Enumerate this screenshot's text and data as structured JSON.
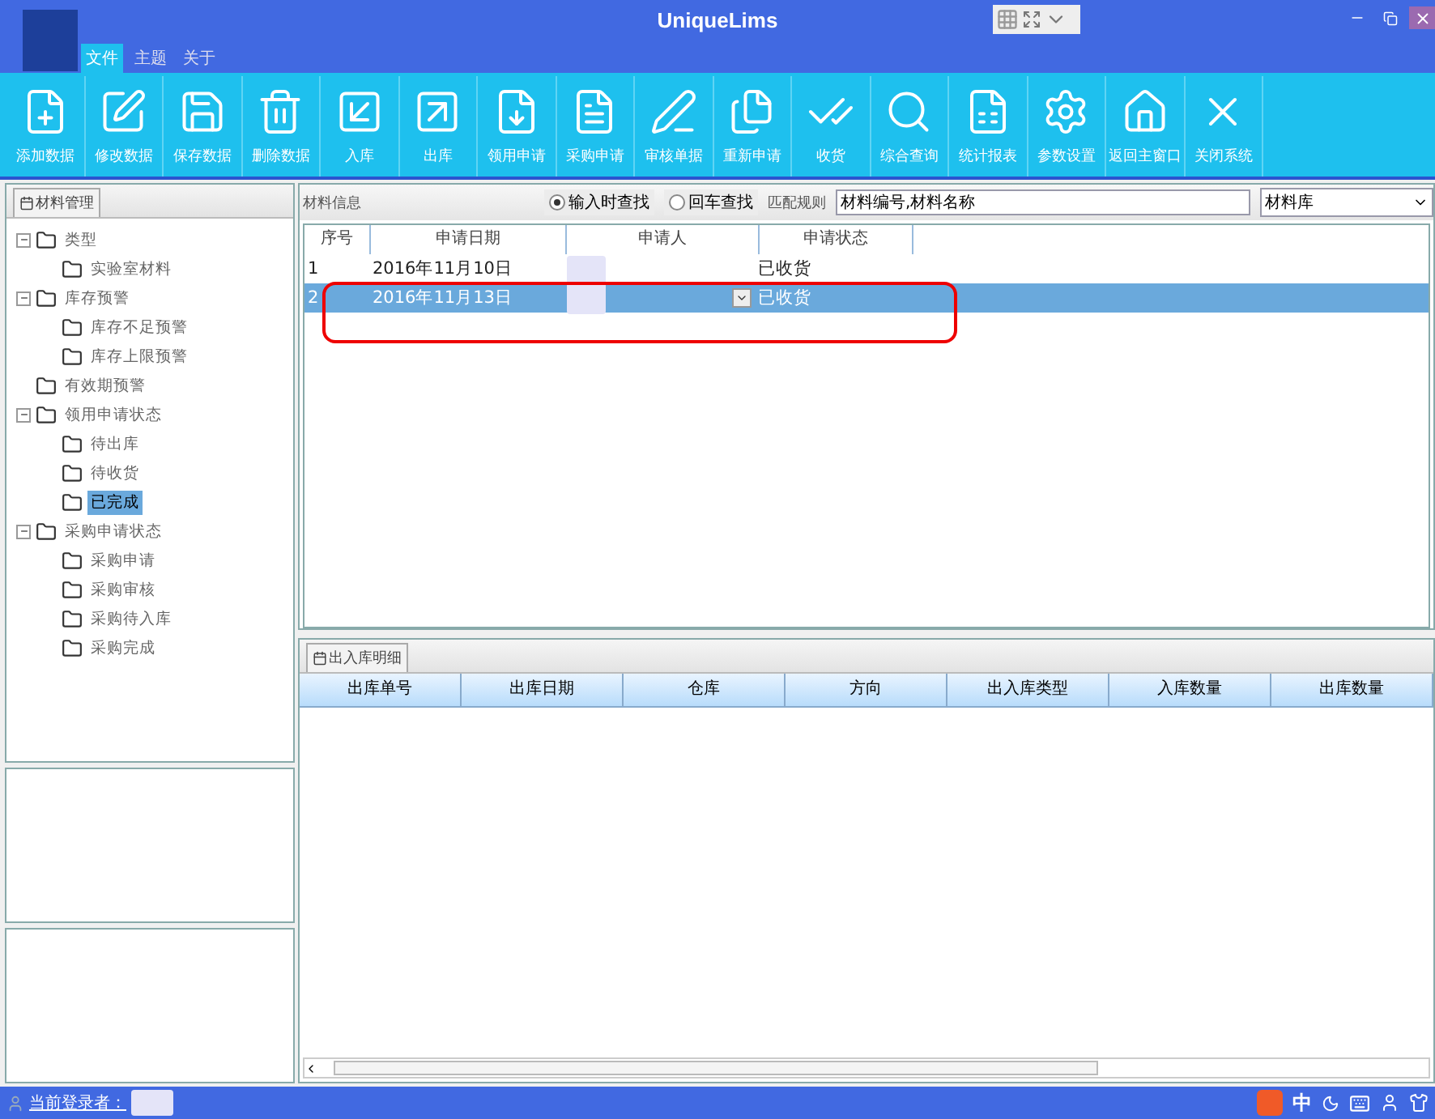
{
  "window": {
    "title": "UniqueLims"
  },
  "menu_tabs": [
    {
      "label": "文件",
      "selected": true
    },
    {
      "label": "主题",
      "selected": false
    },
    {
      "label": "关于",
      "selected": false
    }
  ],
  "toolbar": [
    {
      "label": "添加数据"
    },
    {
      "label": "修改数据"
    },
    {
      "label": "保存数据"
    },
    {
      "label": "删除数据"
    },
    {
      "label": "入库"
    },
    {
      "label": "出库"
    },
    {
      "label": "领用申请"
    },
    {
      "label": "采购申请"
    },
    {
      "label": "审核单据"
    },
    {
      "label": "重新申请"
    },
    {
      "label": "收货"
    },
    {
      "label": "综合查询"
    },
    {
      "label": "统计报表"
    },
    {
      "label": "参数设置"
    },
    {
      "label": "返回主窗口"
    },
    {
      "label": "关闭系统"
    }
  ],
  "left_panel": {
    "tab": "材料管理",
    "tree": [
      {
        "label": "类型",
        "expanded": true,
        "selected": false,
        "children": [
          {
            "label": "实验室材料",
            "selected": false
          }
        ]
      },
      {
        "label": "库存预警",
        "expanded": true,
        "selected": false,
        "children": [
          {
            "label": "库存不足预警",
            "selected": false
          },
          {
            "label": "库存上限预警",
            "selected": false
          }
        ]
      },
      {
        "label": "有效期预警",
        "selected": false
      },
      {
        "label": "领用申请状态",
        "expanded": true,
        "selected": false,
        "children": [
          {
            "label": "待出库",
            "selected": false
          },
          {
            "label": "待收货",
            "selected": false
          },
          {
            "label": "已完成",
            "selected": true
          }
        ]
      },
      {
        "label": "采购申请状态",
        "expanded": true,
        "selected": false,
        "children": [
          {
            "label": "采购申请",
            "selected": false
          },
          {
            "label": "采购审核",
            "selected": false
          },
          {
            "label": "采购待入库",
            "selected": false
          },
          {
            "label": "采购完成",
            "selected": false
          }
        ]
      }
    ]
  },
  "material_panel": {
    "tab": "材料信息",
    "search_modes": [
      {
        "label": "输入时查找",
        "selected": true
      },
      {
        "label": "回车查找",
        "selected": false
      }
    ],
    "match_rule_label": "匹配规则",
    "match_rule_value": "材料编号,材料名称",
    "library_select": "材料库",
    "columns": [
      "序号",
      "申请日期",
      "申请人",
      "申请状态"
    ],
    "rows": [
      {
        "index": "1",
        "date": "2016年11月10日",
        "status": "已收货",
        "selected": false
      },
      {
        "index": "2",
        "date": "2016年11月13日",
        "status": "已收货",
        "selected": true
      }
    ]
  },
  "detail_panel": {
    "tab": "出入库明细",
    "columns": [
      "出库单号",
      "出库日期",
      "仓库",
      "方向",
      "出入库类型",
      "入库数量",
      "出库数量"
    ]
  },
  "status_bar": {
    "login_label": "当前登录者：",
    "ime": "中"
  }
}
